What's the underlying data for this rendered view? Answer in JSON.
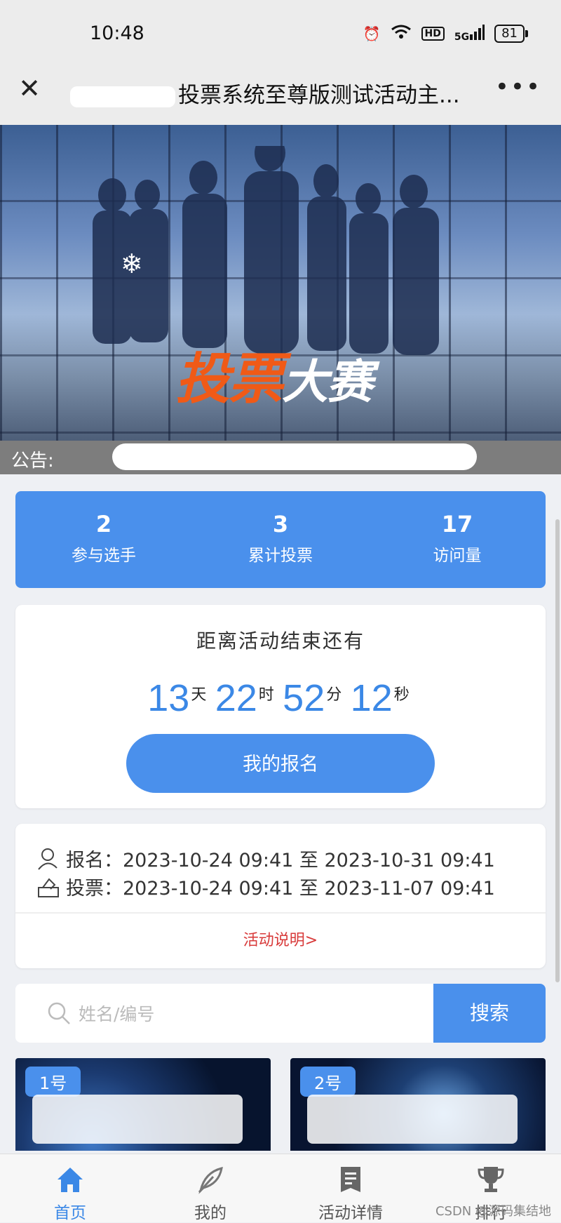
{
  "status_bar": {
    "time": "10:48",
    "network": "5G",
    "hd": "HD",
    "battery": "81"
  },
  "nav": {
    "title": "投票系统至尊版测试活动主...",
    "close_icon": "close-icon",
    "more_icon": "more-icon"
  },
  "banner": {
    "headline_main": "投票",
    "headline_rest": "大赛"
  },
  "notice": {
    "label": "公告:"
  },
  "stats": [
    {
      "value": "2",
      "label": "参与选手"
    },
    {
      "value": "3",
      "label": "累计投票"
    },
    {
      "value": "17",
      "label": "访问量"
    }
  ],
  "countdown": {
    "heading": "距离活动结束还有",
    "days": "13",
    "days_unit": "天",
    "hours": "22",
    "hours_unit": "时",
    "minutes": "52",
    "minutes_unit": "分",
    "seconds": "12",
    "seconds_unit": "秒",
    "button": "我的报名"
  },
  "schedule": {
    "signup": "报名：2023-10-24 09:41 至 2023-10-31 09:41",
    "vote": "投票：2023-10-24 09:41 至 2023-11-07 09:41",
    "link": "活动说明>"
  },
  "search": {
    "placeholder": "姓名/编号",
    "button": "搜索"
  },
  "tiles": [
    {
      "badge": "1号"
    },
    {
      "badge": "2号"
    }
  ],
  "tabbar": [
    {
      "label": "首页",
      "icon": "home-icon"
    },
    {
      "label": "我的",
      "icon": "feather-icon"
    },
    {
      "label": "活动详情",
      "icon": "document-icon"
    },
    {
      "label": "排行",
      "icon": "trophy-icon"
    }
  ],
  "watermark": "CSDN @源码集结地",
  "colors": {
    "primary": "#4a90ec",
    "link_red": "#d83a3a",
    "headline_orange": "#f05a17"
  }
}
